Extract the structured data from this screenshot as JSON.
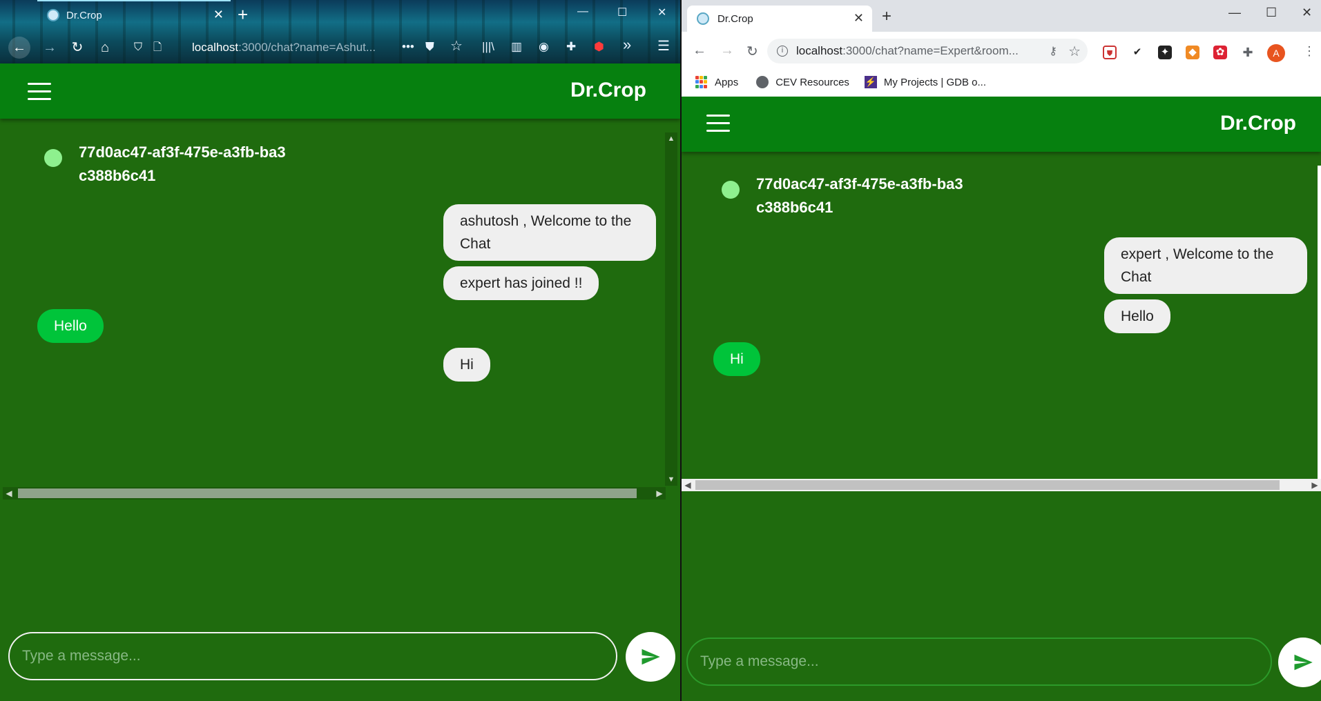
{
  "left": {
    "browser": {
      "tab_title": "Dr.Crop",
      "url_host": "localhost",
      "url_rest": ":3000/chat?name=Ashut...",
      "close_glyph": "✕",
      "new_tab_glyph": "+",
      "more_glyph": "•••",
      "overflow_glyph": "»",
      "menu_glyph": "☰"
    },
    "app": {
      "brand": "Dr.Crop",
      "room_id": "77d0ac47-af3f-475e-a3fb-ba3c388b6c41",
      "messages": [
        {
          "text": "ashutosh , Welcome to the Chat",
          "side": "sent"
        },
        {
          "text": "expert has joined !!",
          "side": "sent"
        },
        {
          "text": "Hello",
          "side": "received"
        },
        {
          "text": "Hi",
          "side": "sent"
        }
      ],
      "input_placeholder": "Type a message..."
    }
  },
  "right": {
    "browser": {
      "tab_title": "Dr.Crop",
      "url_host": "localhost",
      "url_rest": ":3000/chat?name=Expert&room...",
      "close_glyph": "✕",
      "new_tab_glyph": "+",
      "avatar_letter": "A",
      "bookmarks": [
        "Apps",
        "CEV Resources",
        "My Projects | GDB o..."
      ]
    },
    "app": {
      "brand": "Dr.Crop",
      "room_id": "77d0ac47-af3f-475e-a3fb-ba3c388b6c41",
      "messages": [
        {
          "text": "expert , Welcome to the Chat",
          "side": "sent"
        },
        {
          "text": "Hello",
          "side": "sent"
        },
        {
          "text": "Hi",
          "side": "received"
        }
      ],
      "input_placeholder": "Type a message..."
    }
  },
  "colors": {
    "app_bg": "#1f6b0e",
    "appbar": "#06800f",
    "sent_bubble": "#efefef",
    "received_bubble": "#00c43a",
    "status_dot": "#8ef08e",
    "send_icon": "#1f9a2e"
  }
}
